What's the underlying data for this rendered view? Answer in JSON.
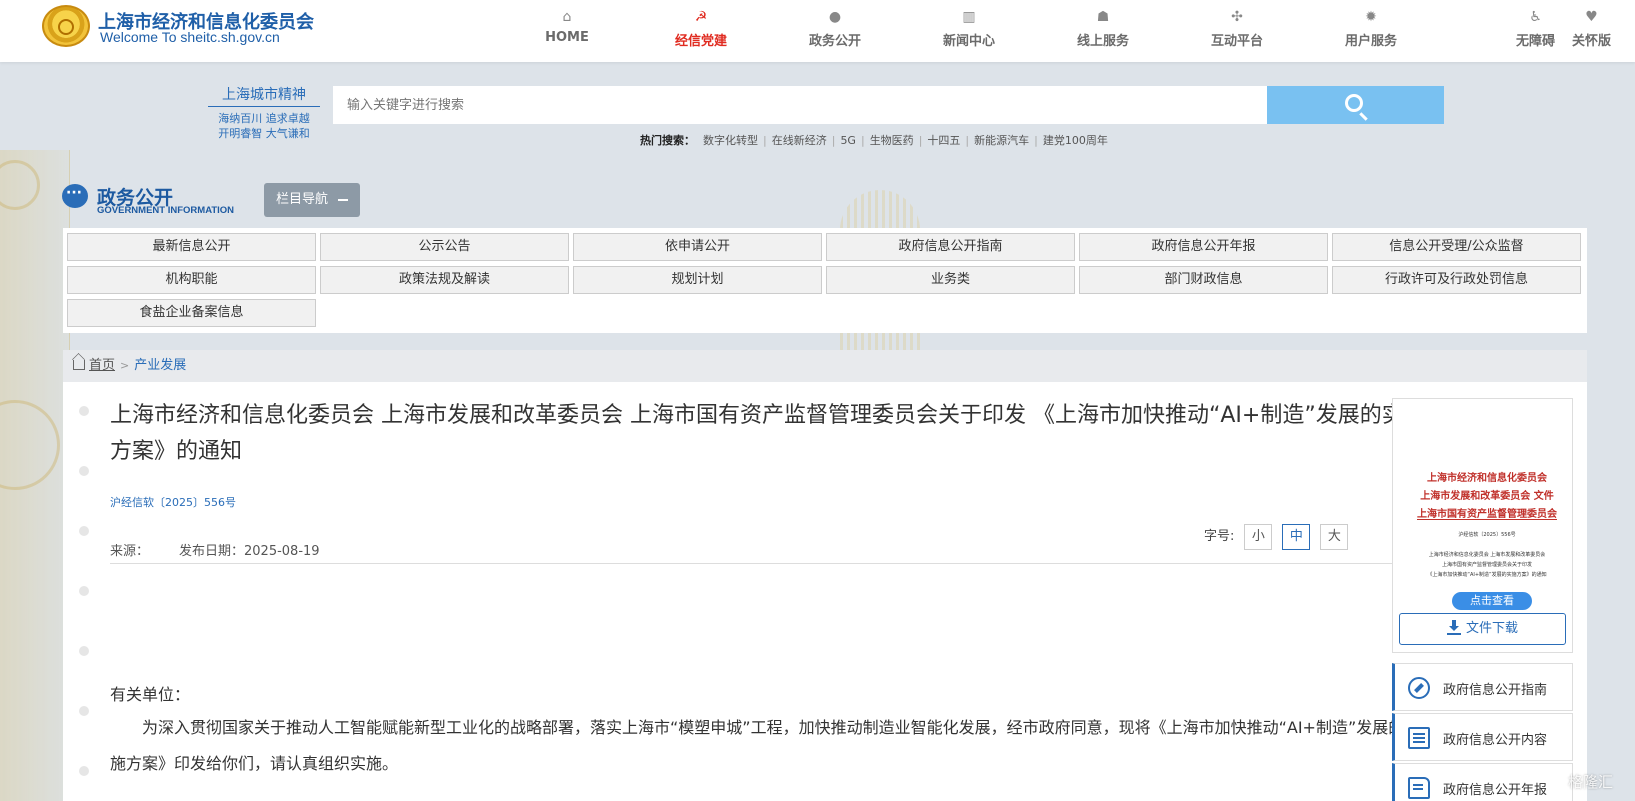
{
  "header": {
    "site_name_cn": "上海市经济和信息化委员会",
    "site_name_en": "Welcome To sheitc.sh.gov.cn",
    "nav": [
      {
        "label": "HOME",
        "icon": "home-icon",
        "active": false
      },
      {
        "label": "经信党建",
        "icon": "party-icon",
        "active": true
      },
      {
        "label": "政务公开",
        "icon": "chat-icon",
        "active": false
      },
      {
        "label": "新闻中心",
        "icon": "news-icon",
        "active": false
      },
      {
        "label": "线上服务",
        "icon": "service-icon",
        "active": false
      },
      {
        "label": "互动平台",
        "icon": "interaction-icon",
        "active": false
      },
      {
        "label": "用户服务",
        "icon": "user-service-icon",
        "active": false
      }
    ],
    "accessibility_label": "无障碍",
    "care_label": "关怀版"
  },
  "spirit": {
    "title": "上海城市精神",
    "line1": "海纳百川 追求卓越",
    "line2": "开明睿智 大气谦和"
  },
  "search": {
    "placeholder": "输入关键字进行搜索",
    "hot_label": "热门搜索：",
    "hot_items": [
      "数字化转型",
      "在线新经济",
      "5G",
      "生物医药",
      "十四五",
      "新能源汽车",
      "建党100周年"
    ]
  },
  "section": {
    "title": "政务公开",
    "subtitle": "GOVERNMENT INFORMATION",
    "column_nav": "栏目导航"
  },
  "categories": [
    "最新信息公开",
    "公示公告",
    "依申请公开",
    "政府信息公开指南",
    "政府信息公开年报",
    "信息公开受理/公众监督",
    "机构职能",
    "政策法规及解读",
    "规划计划",
    "业务类",
    "部门财政信息",
    "行政许可及行政处罚信息",
    "食盐企业备案信息"
  ],
  "breadcrumb": {
    "home": "首页",
    "separator": ">",
    "current": "产业发展"
  },
  "article": {
    "title": "上海市经济和信息化委员会 上海市发展和改革委员会 上海市国有资产监督管理委员会关于印发 《上海市加快推动“AI+制造”发展的实施方案》的通知",
    "doc_number": "沪经信软〔2025〕556号",
    "source_label": "来源：",
    "date_label": "发布日期：2025-08-19",
    "font_size_label": "字号:",
    "font_sizes": [
      "小",
      "中",
      "大"
    ],
    "font_size_selected": "中",
    "salutation": "有关单位：",
    "body": "为深入贯彻国家关于推动人工智能赋能新型工业化的战略部署，落实上海市“模塑申城”工程，加快推动制造业智能化发展，经市政府同意，现将《上海市加快推动“AI+制造”发展的实施方案》印发给你们，请认真组织实施。"
  },
  "sidebar": {
    "thumbnail": {
      "red_line1": "上海市经济和信息化委员会",
      "red_line2": "上海市发展和改革委员会 文件",
      "red_line3": "上海市国有资产监督管理委员会",
      "doc_no_small": "沪经信软〔2025〕556号",
      "tiny_title1": "上海市经济和信息化委员会 上海市发展和改革委员会",
      "tiny_title2": "上海市国有资产监督管理委员会关于印发",
      "tiny_title3": "《上海市加快推动“AI+制造”发展的实施方案》的通知",
      "view_button": "点击查看"
    },
    "download_label": "文件下载",
    "links": [
      {
        "label": "政府信息公开指南",
        "icon": "compass-icon"
      },
      {
        "label": "政府信息公开内容",
        "icon": "list-icon"
      },
      {
        "label": "政府信息公开年报",
        "icon": "report-icon"
      }
    ]
  },
  "watermark": "格隆汇",
  "colors": {
    "brand_blue": "#2a6db8",
    "active_red": "#e02b20",
    "search_button": "#79c1f1",
    "background": "#dde3e9"
  }
}
